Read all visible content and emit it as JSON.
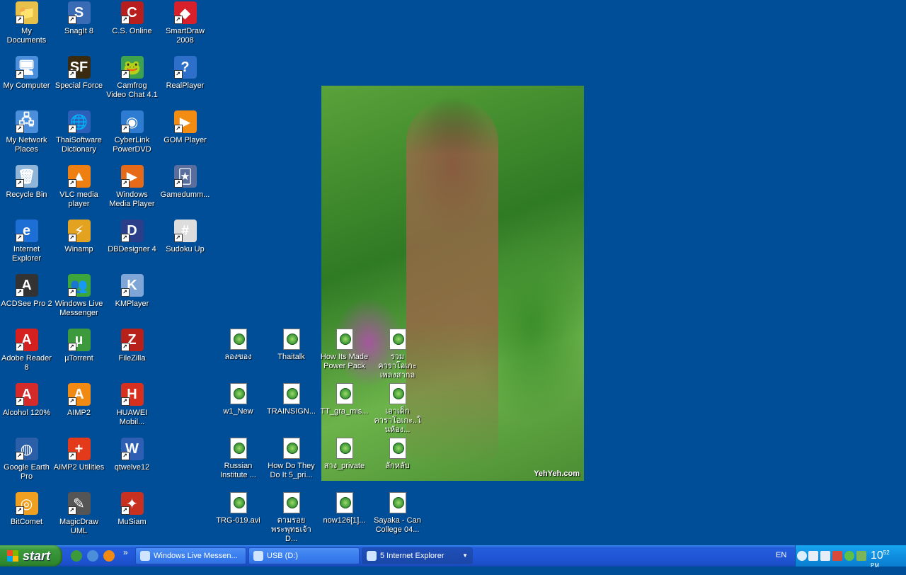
{
  "desktop_icons": [
    {
      "label": "My Documents",
      "icon": "my-documents-icon",
      "color": "#E8C14A",
      "glyph": "📁"
    },
    {
      "label": "SnagIt 8",
      "icon": "snagit-icon",
      "color": "#3A6BB5",
      "glyph": "S"
    },
    {
      "label": "C.S. Online",
      "icon": "cs-online-icon",
      "color": "#B81E1E",
      "glyph": "C"
    },
    {
      "label": "SmartDraw 2008",
      "icon": "smartdraw-icon",
      "color": "#D8202A",
      "glyph": "◆"
    },
    {
      "label": "My Computer",
      "icon": "my-computer-icon",
      "color": "#4B8ED9",
      "glyph": "🖥"
    },
    {
      "label": "Special Force",
      "icon": "special-force-icon",
      "color": "#3A2A10",
      "glyph": "SF"
    },
    {
      "label": "Camfrog Video Chat 4.1",
      "icon": "camfrog-icon",
      "color": "#3FA34D",
      "glyph": "🐸"
    },
    {
      "label": "RealPlayer",
      "icon": "realplayer-icon",
      "color": "#2E6FC9",
      "glyph": "?"
    },
    {
      "label": "My Network Places",
      "icon": "network-places-icon",
      "color": "#4B8ED9",
      "glyph": "🖧"
    },
    {
      "label": "ThaiSoftware Dictionary",
      "icon": "thai-dictionary-icon",
      "color": "#2C5FB8",
      "glyph": "🌐"
    },
    {
      "label": "CyberLink PowerDVD",
      "icon": "powerdvd-icon",
      "color": "#2E7CD1",
      "glyph": "◉"
    },
    {
      "label": "GOM Player",
      "icon": "gom-player-icon",
      "color": "#F28C12",
      "glyph": "▶"
    },
    {
      "label": "Recycle Bin",
      "icon": "recycle-bin-icon",
      "color": "#8FB5D9",
      "glyph": "🗑"
    },
    {
      "label": "VLC media player",
      "icon": "vlc-icon",
      "color": "#F07F12",
      "glyph": "▲"
    },
    {
      "label": "Windows Media Player",
      "icon": "media-player-icon",
      "color": "#E66A18",
      "glyph": "▶"
    },
    {
      "label": "Gamedumm...",
      "icon": "gamedumm-icon",
      "color": "#5A6E9E",
      "glyph": "🃏"
    },
    {
      "label": "Internet Explorer",
      "icon": "internet-explorer-icon",
      "color": "#1D6FD6",
      "glyph": "e"
    },
    {
      "label": "Winamp",
      "icon": "winamp-icon",
      "color": "#E3A321",
      "glyph": "⚡"
    },
    {
      "label": "DBDesigner 4",
      "icon": "dbdesigner-icon",
      "color": "#2A3E8A",
      "glyph": "D"
    },
    {
      "label": "Sudoku Up",
      "icon": "sudoku-icon",
      "color": "#DDDDDD",
      "glyph": "#"
    },
    {
      "label": "ACDSee Pro 2",
      "icon": "acdsee-icon",
      "color": "#333333",
      "glyph": "A"
    },
    {
      "label": "Windows Live Messenger",
      "icon": "live-messenger-icon",
      "color": "#3CA53C",
      "glyph": "👥"
    },
    {
      "label": "KMPlayer",
      "icon": "kmplayer-icon",
      "color": "#7FA6D6",
      "glyph": "K"
    },
    {
      "label": "Adobe Reader 8",
      "icon": "adobe-reader-icon",
      "color": "#D62020",
      "glyph": "A"
    },
    {
      "label": "µTorrent",
      "icon": "utorrent-icon",
      "color": "#3C9A3C",
      "glyph": "µ"
    },
    {
      "label": "FileZilla",
      "icon": "filezilla-icon",
      "color": "#B8201A",
      "glyph": "Z"
    },
    {
      "label": "Alcohol 120%",
      "icon": "alcohol-icon",
      "color": "#D42A2A",
      "glyph": "A"
    },
    {
      "label": "AIMP2",
      "icon": "aimp2-icon",
      "color": "#F08A12",
      "glyph": "A"
    },
    {
      "label": "HUAWEI Mobil...",
      "icon": "huawei-icon",
      "color": "#D8301E",
      "glyph": "H"
    },
    {
      "label": "Google Earth Pro",
      "icon": "google-earth-icon",
      "color": "#2B5FA8",
      "glyph": "◍"
    },
    {
      "label": "AIMP2 Utilities",
      "icon": "aimp2-utilities-icon",
      "color": "#E23A1A",
      "glyph": "+"
    },
    {
      "label": "qtwelve12",
      "icon": "word-document-icon",
      "color": "#2E5FB5",
      "glyph": "W"
    },
    {
      "label": "BitComet",
      "icon": "bitcomet-icon",
      "color": "#F0A020",
      "glyph": "◎"
    },
    {
      "label": "MagicDraw UML",
      "icon": "magicdraw-icon",
      "color": "#555555",
      "glyph": "✎"
    },
    {
      "label": "MuSiam",
      "icon": "musiam-icon",
      "color": "#C83020",
      "glyph": "✦"
    }
  ],
  "file_icons": [
    {
      "label": "ลองของ",
      "icon": "torrent-file-icon"
    },
    {
      "label": "Thaitalk",
      "icon": "torrent-file-icon"
    },
    {
      "label": "How Its Made Power Pack",
      "icon": "torrent-file-icon"
    },
    {
      "label": "รวมคาราโอเกะเพลงสากล",
      "icon": "torrent-file-icon"
    },
    {
      "label": "w1_New",
      "icon": "torrent-file-icon"
    },
    {
      "label": "TRAINSIGN...",
      "icon": "torrent-file-icon"
    },
    {
      "label": "TT_gra_mis...",
      "icon": "torrent-file-icon"
    },
    {
      "label": "เอาเด็กคาราโอเกะ..ในห้อง...",
      "icon": "torrent-file-icon"
    },
    {
      "label": "Russian Institute ...",
      "icon": "torrent-file-icon"
    },
    {
      "label": "How Do They Do It 5_pri...",
      "icon": "torrent-file-icon"
    },
    {
      "label": "สาง_private",
      "icon": "torrent-file-icon"
    },
    {
      "label": "ลักหลับ",
      "icon": "torrent-file-icon"
    },
    {
      "label": "TRG-019.avi",
      "icon": "torrent-file-icon"
    },
    {
      "label": "ตามรอยพระพุทธเจ้า D...",
      "icon": "torrent-file-icon"
    },
    {
      "label": "now126[1]...",
      "icon": "torrent-file-icon"
    },
    {
      "label": "Sayaka - Can College 04...",
      "icon": "torrent-file-icon"
    }
  ],
  "wallpaper": {
    "watermark": "YehYeh.com"
  },
  "taskbar": {
    "start_label": "start",
    "quick_launch": [
      {
        "icon": "utorrent-quicklaunch-icon",
        "color": "#3C9A3C"
      },
      {
        "icon": "show-desktop-icon",
        "color": "#4B8ED9"
      },
      {
        "icon": "aimp2-quicklaunch-icon",
        "color": "#F08A12"
      }
    ],
    "overflow": "»",
    "tasks": [
      {
        "label": "Windows Live Messen...",
        "icon": "live-messenger-task-icon",
        "active": false
      },
      {
        "label": "USB (D:)",
        "icon": "drive-task-icon",
        "active": false
      },
      {
        "label": "5 Internet Explorer",
        "icon": "internet-explorer-task-icon",
        "active": true,
        "group": true
      }
    ],
    "language": "EN",
    "clock": {
      "time": "10",
      "minutes": "52",
      "ampm": "PM"
    }
  },
  "colors": {
    "desktop": "#004E98",
    "taskbar": "#245EDB",
    "start": "#3C9A3C",
    "tray": "#0F8EE0"
  }
}
